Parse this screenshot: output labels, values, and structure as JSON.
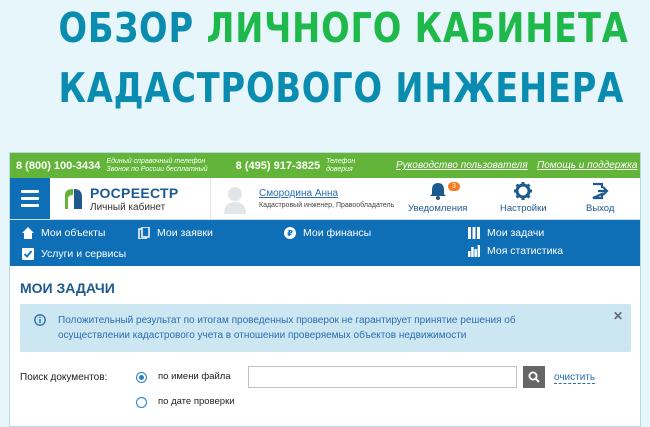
{
  "banner": {
    "line1_part1": "ОБЗОР",
    "line1_part2": "ЛИЧНОГО КАБИНЕТА",
    "line2": "КАДАСТРОВОГО ИНЖЕНЕРА"
  },
  "topbar": {
    "phone1": "8 (800) 100-3434",
    "phone1_caption_line1": "Единый справочный телефон",
    "phone1_caption_line2": "Звонок по России бесплатный",
    "phone2": "8 (495) 917-3825",
    "phone2_caption_line1": "Телефон",
    "phone2_caption_line2": "доверия",
    "link_guide": "Руководство пользователя",
    "link_help": "Помощь и поддержка"
  },
  "header": {
    "logo_title": "РОСРЕЕСТР",
    "logo_subtitle": "Личный кабинет",
    "user_name": "Смородина Анна",
    "user_role": "Кадастровый инженер, Правообладатель",
    "notifications_label": "Уведомления",
    "notifications_count": "3",
    "settings_label": "Настройки",
    "logout_label": "Выход"
  },
  "nav": {
    "my_objects": "Мои объекты",
    "my_requests": "Мои заявки",
    "my_finances": "Мои финансы",
    "my_tasks": "Мои задачи",
    "services": "Услуги и сервисы",
    "my_stats": "Моя статистика"
  },
  "main": {
    "title": "МОИ ЗАДАЧИ",
    "notice": "Положительный результат по итогам проведенных проверок не гарантирует принятие решения об осуществлении кадастрового учета в отношении проверяемых объектов недвижимости",
    "search_label": "Поиск документов:",
    "option_filename": "по имени файла",
    "option_date": "по дате проверки",
    "clear_link": "очистить"
  },
  "colors": {
    "accent_blue": "#0e6fb7",
    "green_bar": "#62b538",
    "badge_orange": "#f47b20",
    "headline_blue": "#0a8bb0",
    "headline_green": "#1fb84a"
  }
}
